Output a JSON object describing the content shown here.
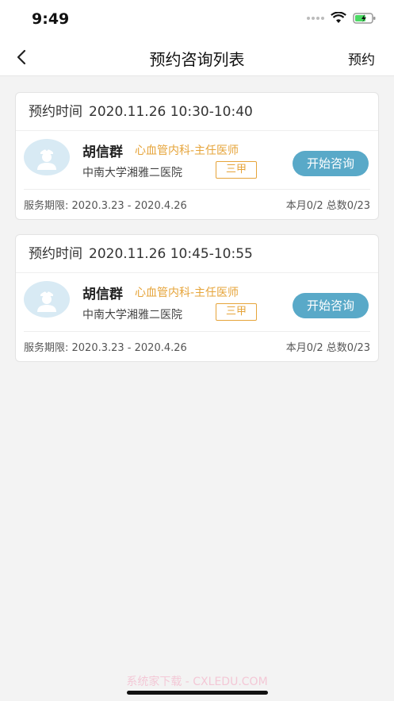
{
  "status": {
    "time": "9:49"
  },
  "header": {
    "title": "预约咨询列表",
    "action_label": "预约"
  },
  "appointments": [
    {
      "time_label": "预约时间",
      "time_value": "2020.11.26 10:30-10:40",
      "doctor_name": "胡信群",
      "department": "心血管内科-主任医师",
      "hospital": "中南大学湘雅二医院",
      "grade": "三甲",
      "consult_label": "开始咨询",
      "service_period": "服务期限: 2020.3.23 - 2020.4.26",
      "usage": "本月0/2 总数0/23"
    },
    {
      "time_label": "预约时间",
      "time_value": "2020.11.26 10:45-10:55",
      "doctor_name": "胡信群",
      "department": "心血管内科-主任医师",
      "hospital": "中南大学湘雅二医院",
      "grade": "三甲",
      "consult_label": "开始咨询",
      "service_period": "服务期限: 2020.3.23 - 2020.4.26",
      "usage": "本月0/2 总数0/23"
    }
  ],
  "watermark": "系统家下载 - CXLEDU.COM",
  "colors": {
    "accent": "#59a9c8",
    "dept": "#e6a43a",
    "background": "#f3f3f3"
  }
}
